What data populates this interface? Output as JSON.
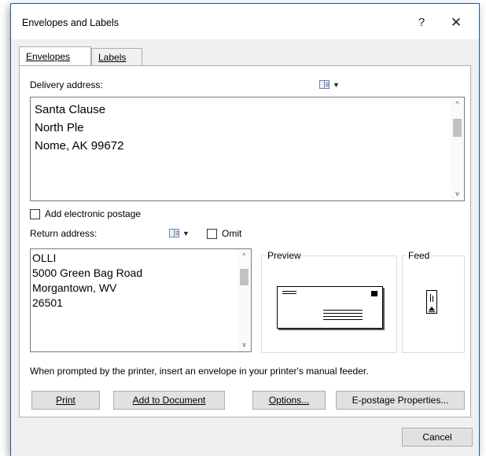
{
  "window": {
    "title": "Envelopes and Labels",
    "help_glyph": "?",
    "close_glyph": "✕"
  },
  "tabs": [
    {
      "label": "Envelopes",
      "active": true
    },
    {
      "label": "Labels",
      "active": false
    }
  ],
  "delivery": {
    "label": "Delivery address:",
    "address": "Santa Clause\nNorth Ple\nNome, AK 99672"
  },
  "postage": {
    "label": "Add electronic postage",
    "checked": false
  },
  "return_addr": {
    "label": "Return address:",
    "address": "OLLI\n5000 Green Bag Road\nMorgantown, WV\n26501",
    "omit_label": "Omit",
    "omit_checked": false
  },
  "preview": {
    "title": "Preview"
  },
  "feed": {
    "title": "Feed"
  },
  "instruction": "When prompted by the printer, insert an envelope in your printer's manual feeder.",
  "buttons": {
    "print": "Print",
    "add_to_document": "Add to Document",
    "options": "Options...",
    "epostage": "E-postage Properties...",
    "cancel": "Cancel"
  },
  "icons": {
    "address_book": "address-book-icon",
    "dropdown": "▼",
    "scroll_up": "^",
    "scroll_down": "v"
  }
}
